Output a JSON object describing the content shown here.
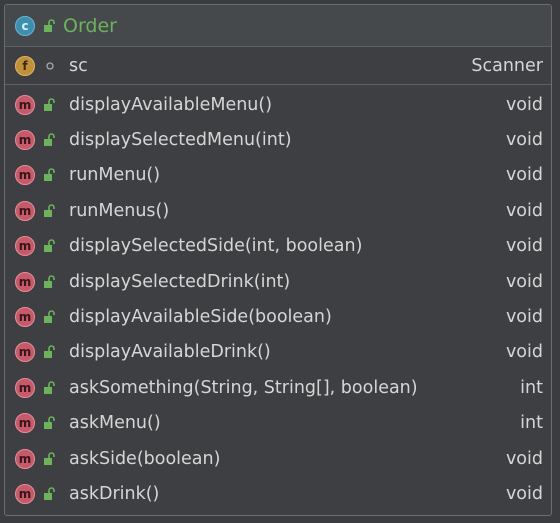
{
  "class": {
    "badge": "c",
    "name": "Order"
  },
  "fields": [
    {
      "badge": "f",
      "visibility": "package-private",
      "name": "sc",
      "type": "Scanner"
    }
  ],
  "methods": [
    {
      "badge": "m",
      "visibility": "public",
      "name": "displayAvailableMenu()",
      "type": "void"
    },
    {
      "badge": "m",
      "visibility": "public",
      "name": "displaySelectedMenu(int)",
      "type": "void"
    },
    {
      "badge": "m",
      "visibility": "public",
      "name": "runMenu()",
      "type": "void"
    },
    {
      "badge": "m",
      "visibility": "public",
      "name": "runMenus()",
      "type": "void"
    },
    {
      "badge": "m",
      "visibility": "public",
      "name": "displaySelectedSide(int, boolean)",
      "type": "void"
    },
    {
      "badge": "m",
      "visibility": "public",
      "name": "displaySelectedDrink(int)",
      "type": "void"
    },
    {
      "badge": "m",
      "visibility": "public",
      "name": "displayAvailableSide(boolean)",
      "type": "void"
    },
    {
      "badge": "m",
      "visibility": "public",
      "name": "displayAvailableDrink()",
      "type": "void"
    },
    {
      "badge": "m",
      "visibility": "public",
      "name": "askSomething(String, String[], boolean)",
      "type": "int"
    },
    {
      "badge": "m",
      "visibility": "public",
      "name": "askMenu()",
      "type": "int"
    },
    {
      "badge": "m",
      "visibility": "public",
      "name": "askSide(boolean)",
      "type": "void"
    },
    {
      "badge": "m",
      "visibility": "public",
      "name": "askDrink()",
      "type": "void"
    }
  ],
  "colors": {
    "background": "#3d3f42",
    "class_name": "#6db35c",
    "text": "#d6d6d6",
    "class_badge": "#3d8fb0",
    "field_badge": "#c1903a",
    "method_badge": "#c45a6a",
    "public_lock": "#6db35c"
  }
}
